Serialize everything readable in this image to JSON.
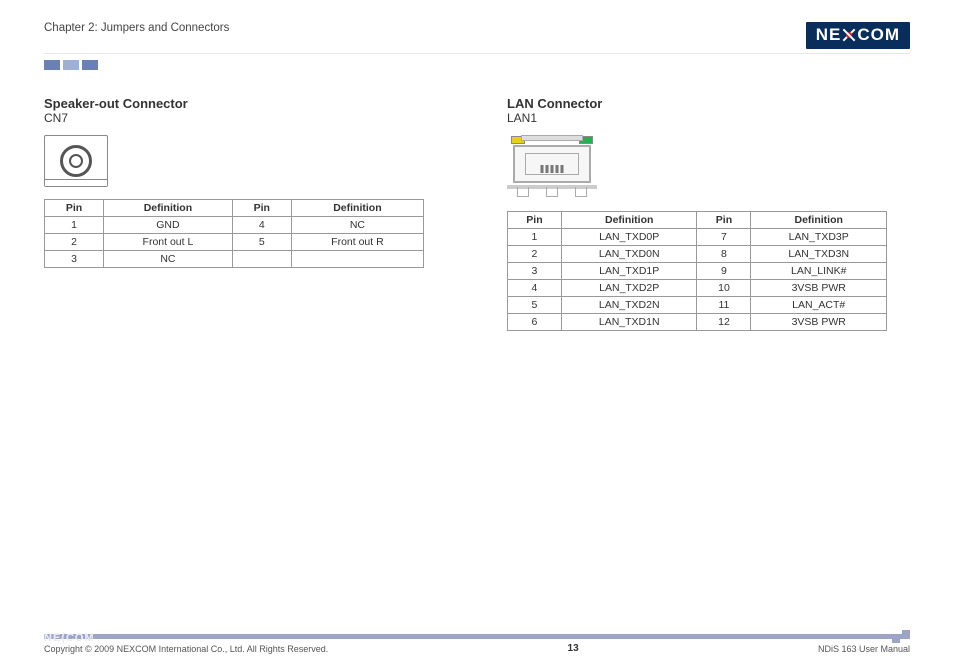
{
  "header": {
    "chapter": "Chapter 2: Jumpers and Connectors",
    "logo_left": "NE",
    "logo_right": "COM"
  },
  "left": {
    "title": "Speaker-out Connector",
    "sub": "CN7",
    "table": {
      "headers": [
        "Pin",
        "Definition",
        "Pin",
        "Definition"
      ],
      "rows": [
        [
          "1",
          "GND",
          "4",
          "NC"
        ],
        [
          "2",
          "Front out L",
          "5",
          "Front out R"
        ],
        [
          "3",
          "NC",
          "",
          ""
        ]
      ]
    }
  },
  "right": {
    "title": "LAN Connector",
    "sub": "LAN1",
    "table": {
      "headers": [
        "Pin",
        "Definition",
        "Pin",
        "Definition"
      ],
      "rows": [
        [
          "1",
          "LAN_TXD0P",
          "7",
          "LAN_TXD3P"
        ],
        [
          "2",
          "LAN_TXD0N",
          "8",
          "LAN_TXD3N"
        ],
        [
          "3",
          "LAN_TXD1P",
          "9",
          "LAN_LINK#"
        ],
        [
          "4",
          "LAN_TXD2P",
          "10",
          "3VSB PWR"
        ],
        [
          "5",
          "LAN_TXD2N",
          "11",
          "LAN_ACT#"
        ],
        [
          "6",
          "LAN_TXD1N",
          "12",
          "3VSB PWR"
        ]
      ]
    }
  },
  "footer": {
    "logo": "NE(COM",
    "copyright": "Copyright © 2009 NEXCOM International Co., Ltd. All Rights Reserved.",
    "page": "13",
    "doc": "NDiS 163 User Manual"
  }
}
